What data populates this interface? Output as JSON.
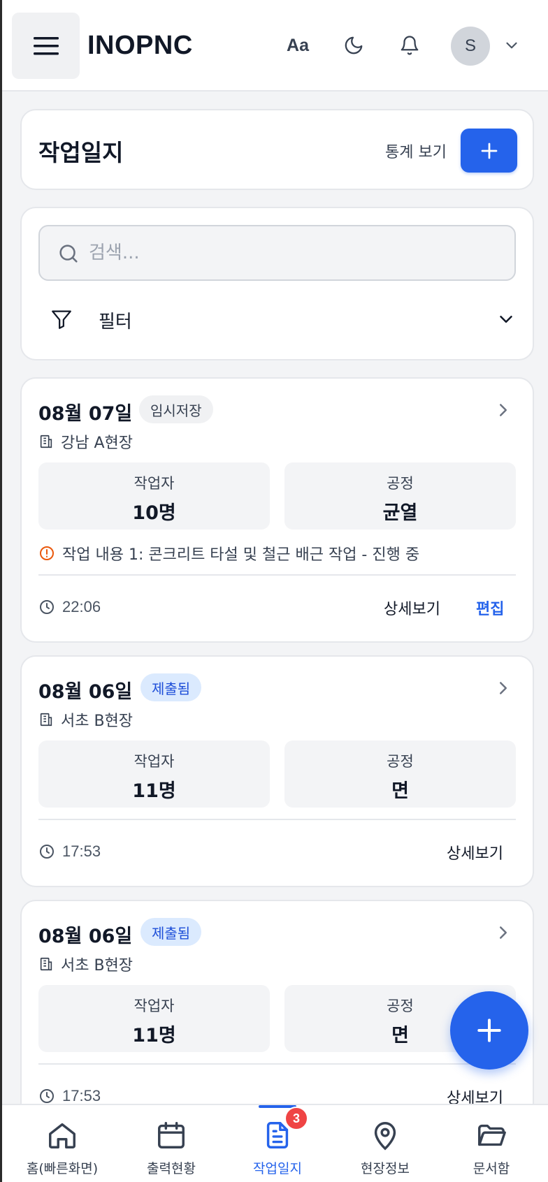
{
  "header": {
    "app_title": "INOPNC",
    "font_toggle_label": "Aa",
    "avatar_initial": "S",
    "icons": [
      "menu-icon",
      "moon-icon",
      "bell-icon",
      "chevron-down-icon"
    ]
  },
  "page": {
    "title": "작업일지",
    "stats_link": "통계 보기"
  },
  "search": {
    "placeholder": "검색...",
    "value": ""
  },
  "filter": {
    "label": "필터"
  },
  "logs": [
    {
      "date": "08월 07일",
      "status": "임시저장",
      "status_type": "draft",
      "site": "강남 A현장",
      "workers_label": "작업자",
      "workers_value": "10명",
      "process_label": "공정",
      "process_value": "균열",
      "note": "작업 내용 1: 콘크리트 타설 및 철근 배근 작업 - 진행 중",
      "time": "22:06",
      "detail_label": "상세보기",
      "edit_label": "편집"
    },
    {
      "date": "08월 06일",
      "status": "제출됨",
      "status_type": "submitted",
      "site": "서초 B현장",
      "workers_label": "작업자",
      "workers_value": "11명",
      "process_label": "공정",
      "process_value": "면",
      "time": "17:53",
      "detail_label": "상세보기"
    },
    {
      "date": "08월 06일",
      "status": "제출됨",
      "status_type": "submitted",
      "site": "서초 B현장",
      "workers_label": "작업자",
      "workers_value": "11명",
      "process_label": "공정",
      "process_value": "면",
      "time": "17:53",
      "detail_label": "상세보기"
    }
  ],
  "bottom_nav": {
    "items": [
      {
        "label": "홈(빠른화면)",
        "icon": "home-icon"
      },
      {
        "label": "출력현황",
        "icon": "calendar-icon"
      },
      {
        "label": "작업일지",
        "icon": "document-icon",
        "active": true,
        "badge": "3"
      },
      {
        "label": "현장정보",
        "icon": "map-pin-icon"
      },
      {
        "label": "문서함",
        "icon": "folder-icon"
      }
    ]
  },
  "colors": {
    "accent": "#2563eb",
    "badge_red": "#ef4444",
    "warning_orange": "#ea580c"
  }
}
